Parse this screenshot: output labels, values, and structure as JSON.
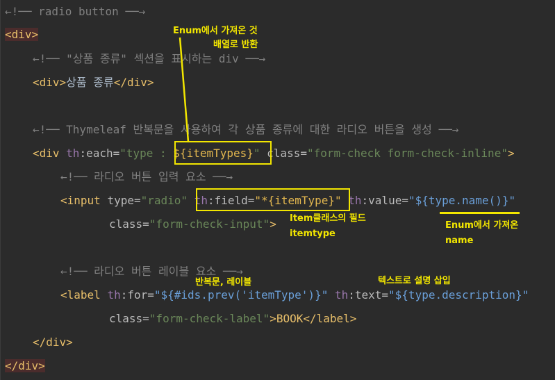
{
  "code": {
    "l1": "←!── radio button ──→",
    "l2": "<div>",
    "l3": "←!── \"상품 종류\" 섹션을 표시하는 div ──→",
    "l4_open": "<div>",
    "l4_text": "상품 종류",
    "l4_close": "</div>",
    "l5": "←!── Thymeleaf 반복문을 사용하여 각 상품 종류에 대한 라디오 버튼을 생성 ──→",
    "l6_tag": "<div ",
    "l6_attr_ns": "th",
    "l6_attr": ":each=",
    "l6_val1": "\"type : ",
    "l6_expr": "${itemTypes}",
    "l6_q": "\"",
    "l6_class_attr": " class=",
    "l6_class_val": "\"form-check form-check-inline\"",
    "l6_end": ">",
    "l7": "←!── 라디오 버튼 입력 요소 ──→",
    "l8_tag": "<input ",
    "l8_type_attr": "type=",
    "l8_type_val": "\"radio\"",
    "l8_field_ns": " th",
    "l8_field_attr": ":field=",
    "l8_field_val": "\"*{itemType}\"",
    "l8_value_ns": " th",
    "l8_value_attr": ":value=",
    "l8_value_val": "\"${type.name()}\"",
    "l9_attr": "class=",
    "l9_val": "\"form-check-input\"",
    "l9_end": ">",
    "l10": "←!── 라디오 버튼 레이블 요소 ──→",
    "l11_tag": "<label ",
    "l11_for_ns": "th",
    "l11_for_attr": ":for=",
    "l11_for_val": "\"${#ids.prev('itemType')}\"",
    "l11_text_ns": " th",
    "l11_text_attr": ":text=",
    "l11_text_val": "\"${type.description}\"",
    "l12_attr": "class=",
    "l12_val": "\"form-check-label\"",
    "l12_text": ">BOOK</",
    "l12_close_tag": "label",
    "l12_end": ">",
    "l13": "</div>",
    "l14": "</div>"
  },
  "annotations": {
    "enum_array_1": "Enum에서 가져온 것",
    "enum_array_2": "배열로 반환",
    "item_field_1": "Item클래스의 필드",
    "item_field_2": "itemtype",
    "enum_name_1": "Enum에서 가져온",
    "enum_name_2": "name",
    "loop_label": "반복문, 레이블",
    "text_insert": "텍스트로 설명 삽입"
  },
  "colors": {
    "highlight": "#f2e600",
    "background": "#2b2b2b"
  }
}
